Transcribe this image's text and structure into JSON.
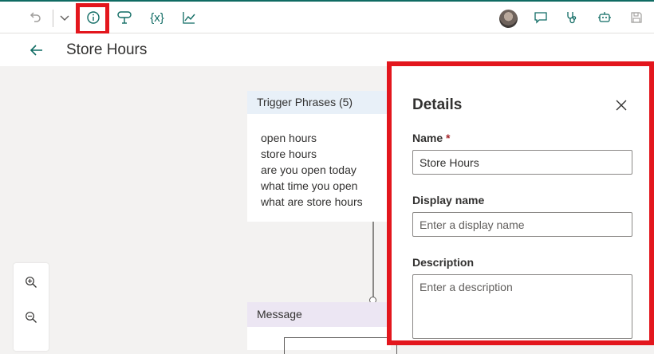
{
  "toolbar": {
    "undo_icon": "undo-icon",
    "dropdown_icon": "chevron-down-icon",
    "info_icon": "info-icon",
    "topic_icon": "topic-checker-icon",
    "variables_label": "{x}",
    "analytics_icon": "analytics-icon",
    "chat_icon": "chat-icon",
    "test_icon": "stethoscope-icon",
    "bot_icon": "bot-icon",
    "save_icon": "save-icon",
    "highlight_color": "#e3161d",
    "accent_color": "#0f6b63"
  },
  "header": {
    "title": "Store Hours",
    "back_icon": "arrow-left-icon"
  },
  "canvas": {
    "trigger_card": {
      "title": "Trigger Phrases (5)",
      "phrases": [
        "open hours",
        "store hours",
        "are you open today",
        "what time you open",
        "what are store hours"
      ]
    },
    "message_card": {
      "title": "Message"
    },
    "zoom": {
      "zoom_in_icon": "zoom-in-icon",
      "zoom_out_icon": "zoom-out-icon"
    }
  },
  "details": {
    "title": "Details",
    "close_icon": "close-icon",
    "name_label": "Name",
    "required_marker": "*",
    "name_value": "Store Hours",
    "display_name_label": "Display name",
    "display_name_placeholder": "Enter a display name",
    "description_label": "Description",
    "description_placeholder": "Enter a description"
  }
}
